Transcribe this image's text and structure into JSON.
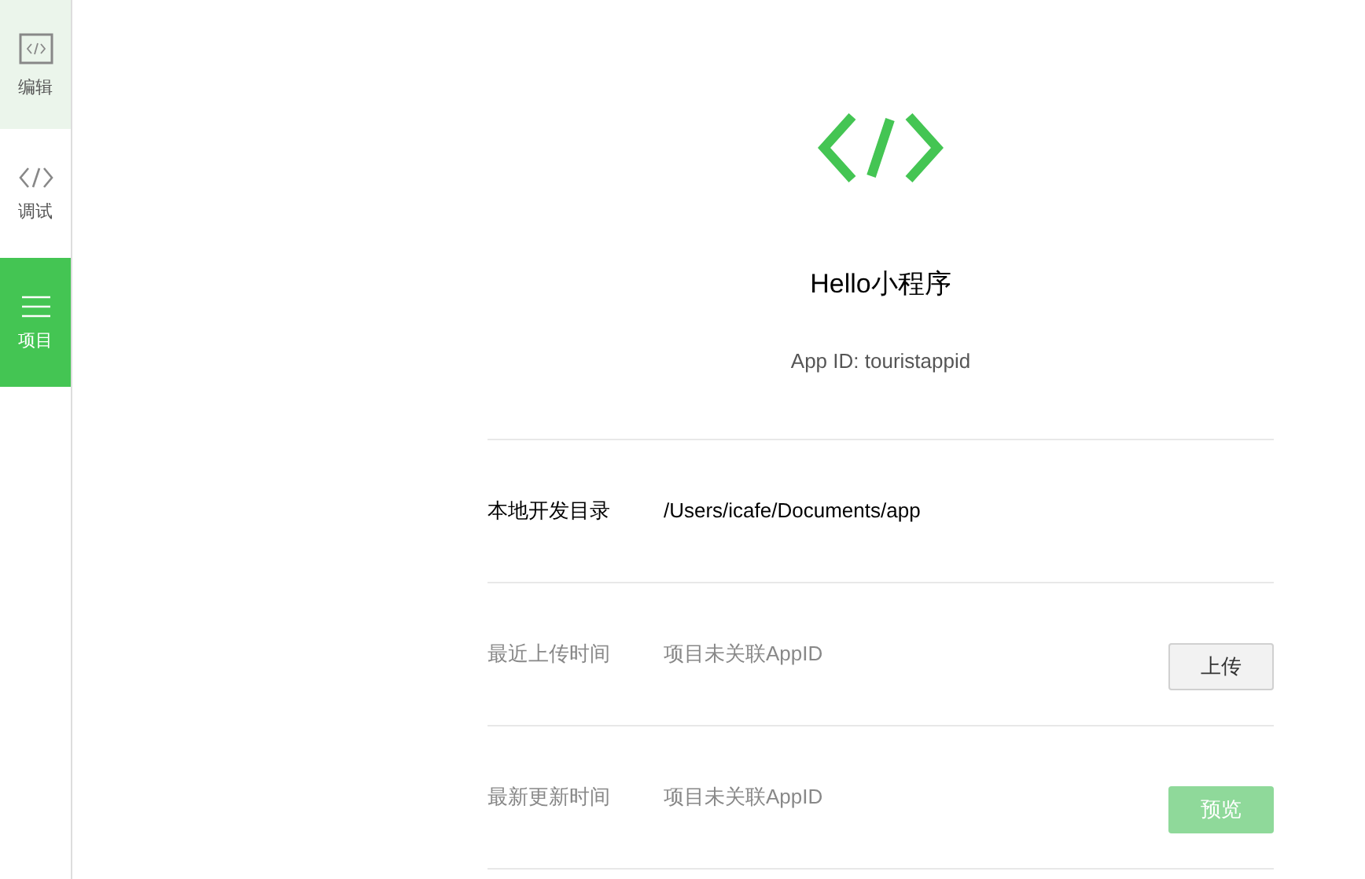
{
  "sidebar": {
    "items": [
      {
        "kind": "editor",
        "label": "编辑",
        "selected": false,
        "highlighted": true
      },
      {
        "kind": "debug",
        "label": "调试",
        "selected": false,
        "highlighted": false
      },
      {
        "kind": "project",
        "label": "项目",
        "selected": true
      }
    ]
  },
  "project": {
    "title": "Hello小程序",
    "app_id": "App ID: touristappid"
  },
  "rows": [
    {
      "label": "本地开发目录",
      "value": "/Users/icafe/Documents/app",
      "disabled": false
    },
    {
      "label": "最近上传时间",
      "value": "项目未关联AppID",
      "disabled": true,
      "button": {
        "label": "上传",
        "kind": "default"
      }
    },
    {
      "label": "最新更新时间",
      "value": "项目未关联AppID",
      "disabled": true,
      "button": {
        "label": "预览",
        "kind": "primary",
        "disabled": true
      }
    }
  ]
}
